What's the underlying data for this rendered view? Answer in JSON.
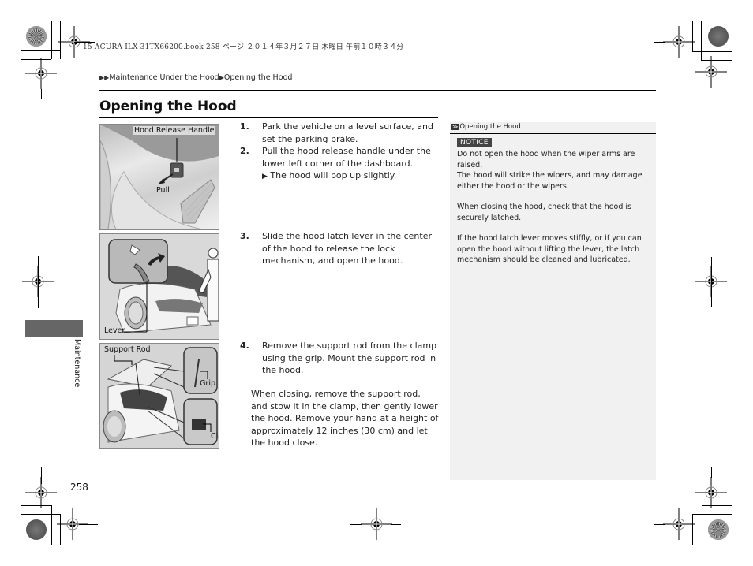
{
  "print_header": "15 ACURA ILX-31TX66200.book  258 ページ  ２０１４年３月２７日  木曜日  午前１０時３４分",
  "breadcrumb": {
    "marker": "▶▶",
    "items": [
      "Maintenance Under the Hood",
      "Opening the Hood"
    ],
    "separator": "▶"
  },
  "section_title": "Opening the Hood",
  "figures": [
    {
      "name": "hood-release-handle",
      "labels": [
        "Hood Release Handle",
        "Pull"
      ]
    },
    {
      "name": "hood-latch-lever",
      "labels": [
        "Lever"
      ]
    },
    {
      "name": "support-rod",
      "labels": [
        "Support Rod",
        "Grip",
        "Clamp"
      ]
    }
  ],
  "steps": [
    {
      "num": "1.",
      "text": "Park the vehicle on a level surface, and set the parking brake."
    },
    {
      "num": "2.",
      "text": "Pull the hood release handle under the lower left corner of the dashboard.",
      "sub": "The hood will pop up slightly.",
      "sub_marker": "▶"
    },
    {
      "num": "3.",
      "text": "Slide the hood latch lever in the center of the hood to release the lock mechanism, and open the hood."
    },
    {
      "num": "4.",
      "text": "Remove the support rod from the clamp using the grip. Mount the support rod in the hood."
    }
  ],
  "closing_paragraph": "When closing, remove the support rod, and stow it in the clamp, then gently lower the hood. Remove your hand at a height of approximately 12 inches (30 cm) and let the hood close.",
  "sidebar": {
    "ref_marker": "≫",
    "title": "Opening the Hood",
    "notice_label": "NOTICE",
    "paragraphs": [
      "Do not open the hood when the wiper arms are raised.",
      "The hood will strike the wipers, and may damage either the hood or the wipers.",
      "When closing the hood, check that the hood is securely latched.",
      "If the hood latch lever moves stiffly, or if you can open the hood without lifting the lever, the latch mechanism should be cleaned and lubricated."
    ]
  },
  "side_tab_label": "Maintenance",
  "page_number": "258",
  "colors": {
    "tab_gray": "#666666",
    "sidebar_bg": "#f1f1f1",
    "notice_bg": "#444444"
  }
}
